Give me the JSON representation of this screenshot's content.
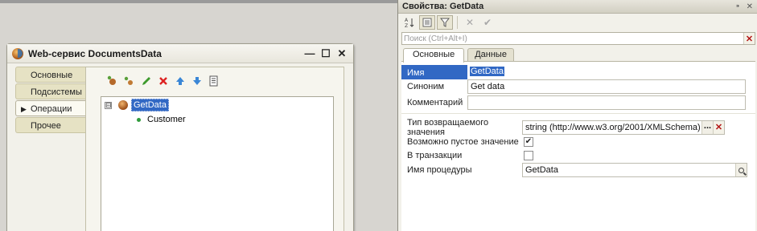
{
  "window": {
    "title": "Web-сервис DocumentsData",
    "controls": {
      "minimize": "—",
      "maximize": "☐",
      "close": "✕"
    },
    "tabs": [
      {
        "label": "Основные",
        "active": false
      },
      {
        "label": "Подсистемы",
        "active": false
      },
      {
        "label": "Операции",
        "active": true
      },
      {
        "label": "Прочее",
        "active": false
      }
    ],
    "toolbar_icons": [
      "add-operation-icon",
      "add-parameter-icon",
      "edit-icon",
      "delete-icon",
      "move-up-icon",
      "move-down-icon",
      "list-icon"
    ],
    "tree": {
      "operation": "GetData",
      "expander": "⊟",
      "parameter": "Customer"
    }
  },
  "properties": {
    "title": "Свойства: GetData",
    "title_controls": {
      "pin": "⁍",
      "close": "✕"
    },
    "search_placeholder": "Поиск (Ctrl+Alt+I)",
    "tabs": [
      {
        "label": "Основные",
        "active": true
      },
      {
        "label": "Данные",
        "active": false
      }
    ],
    "fields": {
      "name_label": "Имя",
      "name_value": "GetData",
      "synonym_label": "Синоним",
      "synonym_value": "Get data",
      "comment_label": "Комментарий",
      "comment_value": "",
      "return_type_label": "Тип возвращаемого значения",
      "return_type_value": "string (http://www.w3.org/2001/XMLSchema)",
      "nillable_label": "Возможно пустое значение",
      "nillable_checked": true,
      "transaction_label": "В транзакции",
      "transaction_checked": false,
      "procedure_label": "Имя процедуры",
      "procedure_value": "GetData"
    },
    "colors": {
      "selection": "#3168c4",
      "delete_red": "#b31515"
    }
  }
}
